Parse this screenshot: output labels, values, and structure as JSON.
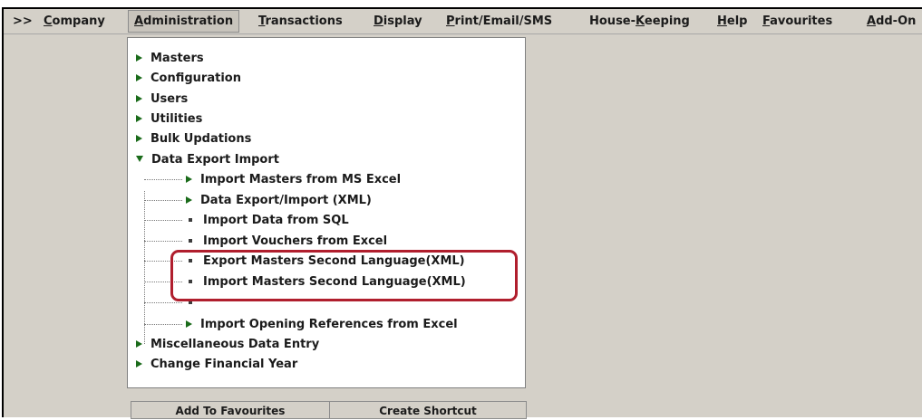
{
  "menubar": {
    "prefix": ">>",
    "items": [
      {
        "label": "Company",
        "underline": "C",
        "rest": "ompany"
      },
      {
        "label": "Administration",
        "underline": "A",
        "rest": "dministration"
      },
      {
        "label": "Transactions",
        "underline": "T",
        "rest": "ransactions"
      },
      {
        "label": "Display",
        "underline": "D",
        "rest": "isplay"
      },
      {
        "label": "Print/Email/SMS",
        "underline": "P",
        "rest": "rint/Email/SMS"
      },
      {
        "label": "House-Keeping",
        "pre": "House-",
        "underline": "K",
        "rest": "eeping"
      },
      {
        "label": "Help",
        "underline": "H",
        "rest": "elp"
      },
      {
        "label": "Favourites",
        "underline": "F",
        "rest": "avourites"
      },
      {
        "label": "Add-On",
        "underline": "A",
        "rest": "dd-On"
      }
    ]
  },
  "tree": {
    "top_items": [
      "Masters",
      "Configuration",
      "Users",
      "Utilities",
      "Bulk Updations"
    ],
    "expanded": "Data Export Import",
    "children": [
      "Import Masters from MS Excel",
      "Data Export/Import (XML)",
      "Import Data from SQL",
      "Import Vouchers from Excel",
      "Export Masters Second Language(XML)",
      "Import Masters Second Language(XML)",
      "",
      "Import Opening References from Excel"
    ],
    "bottom_items": [
      "Miscellaneous Data Entry",
      "Change Financial Year"
    ]
  },
  "buttons": {
    "add_to_favourites": "Add To Favourites",
    "create_shortcut": "Create Shortcut"
  },
  "colors": {
    "highlight": "#b01e2d",
    "arrow": "#1a6b1a",
    "panel": "#d4d0c8"
  }
}
